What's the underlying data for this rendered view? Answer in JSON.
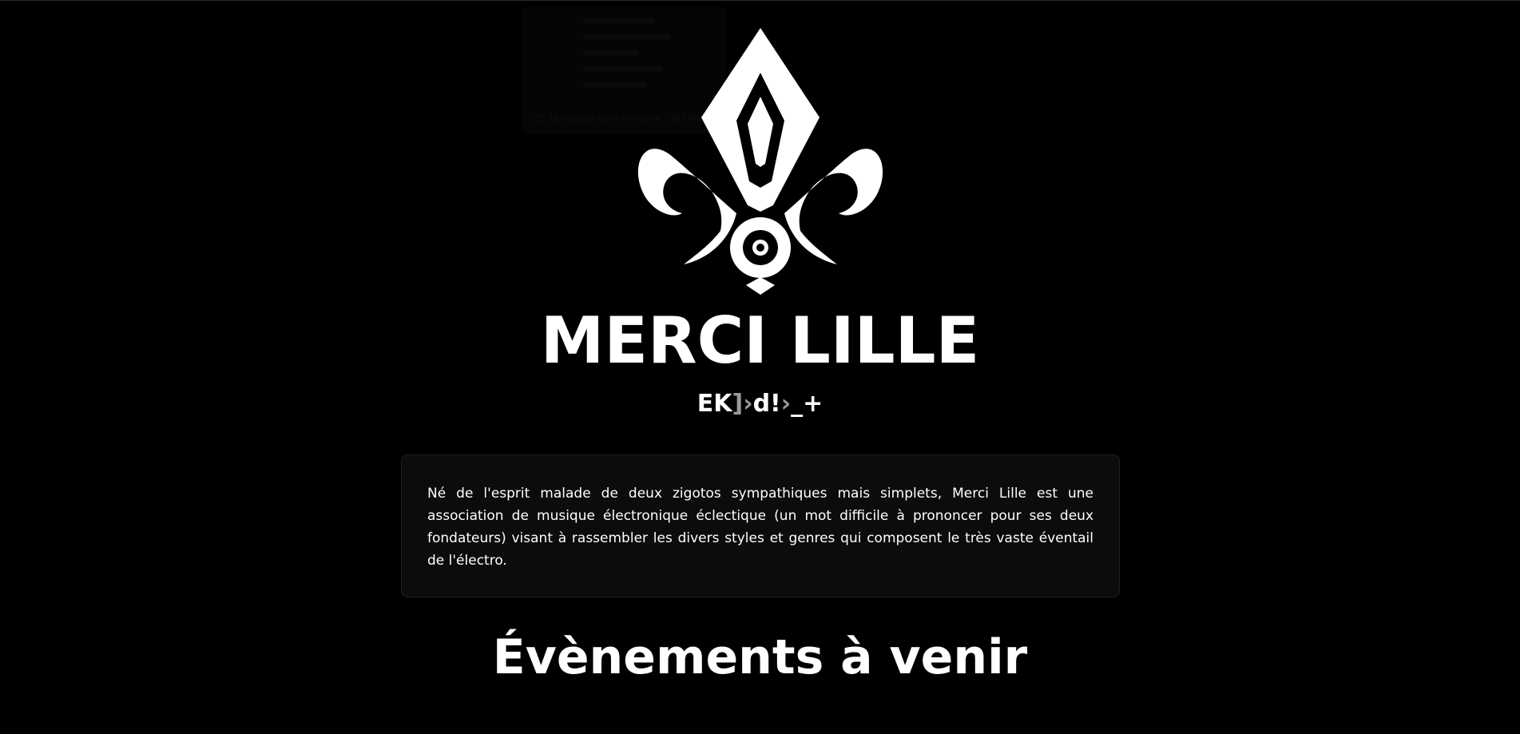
{
  "header": {
    "logo_icon": "fleur-de-lis-icon",
    "title": "MERCI LILLE",
    "tagline": {
      "part1": "EK",
      "part2": "]›",
      "part3": "d!",
      "part4": "›",
      "part5": "_+"
    }
  },
  "background_panel": {
    "footer_text": "Utilisation de la mémoire : 461 Mo"
  },
  "about": {
    "text": "Né de l'esprit malade de deux zigotos sympathiques mais simplets, Merci Lille est une association de musique électronique éclectique (un mot difficile à prononcer pour ses deux fondateurs) visant à rassembler les divers styles et genres qui composent le très vaste éventail de l'électro."
  },
  "events": {
    "title": "Évènements à venir"
  },
  "colors": {
    "background": "#000000",
    "text": "#ffffff",
    "card_background": "#0c0c0c",
    "card_border": "#1f1f1f",
    "tagline_dim": "#9a9a9a"
  }
}
